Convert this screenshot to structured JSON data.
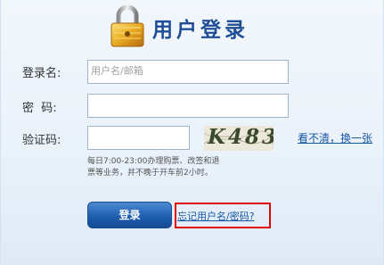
{
  "header": {
    "title": "用户登录",
    "icon": "lock-icon"
  },
  "form": {
    "username_label": "登录名:",
    "username_placeholder": "用户名/邮箱",
    "username_value": "",
    "password_label": "密  码:",
    "password_value": "",
    "captcha_label": "验证码:",
    "captcha_value": "",
    "captcha_image_text": "K483",
    "refresh_link": "看不清，换一张",
    "note_line1": "每日7:00-23:00办理购票、改签和退",
    "note_line2": "票等业务，并不晚于开车前2小时。",
    "login_button": "登录",
    "forgot_link": "忘记用户名/密码?"
  },
  "colors": {
    "title": "#1f4e96",
    "link": "#1857a8",
    "highlight_box": "#e00000",
    "button": "#1f5fb1"
  }
}
